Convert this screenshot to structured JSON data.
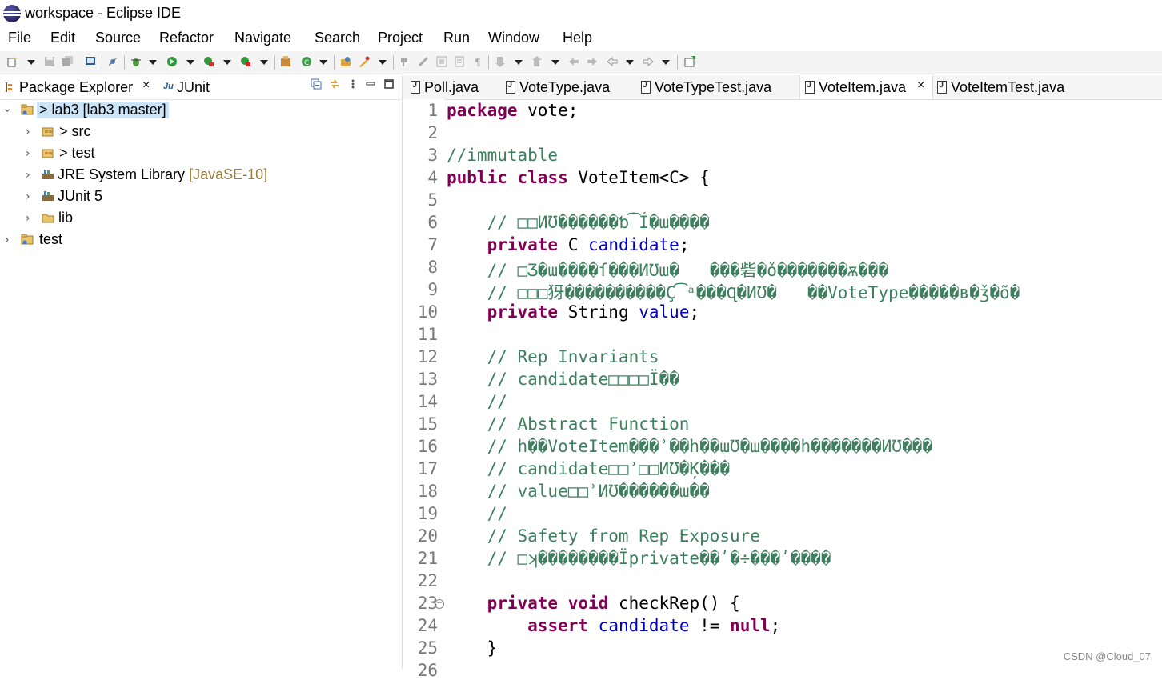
{
  "window": {
    "title": "workspace - Eclipse IDE"
  },
  "menu": [
    "File",
    "Edit",
    "Source",
    "Refactor",
    "Navigate",
    "Search",
    "Project",
    "Run",
    "Window",
    "Help"
  ],
  "left_view": {
    "tabs": [
      {
        "label": "Package Explorer",
        "icon": "package-icon"
      },
      {
        "label": "JUnit",
        "icon": "junit-icon"
      }
    ],
    "tree": [
      {
        "label": "> lab3 [lab3 master]",
        "icon": "project-icon",
        "level": 0,
        "expanded": true,
        "selected": true
      },
      {
        "label": "> src",
        "icon": "source-folder-icon",
        "level": 1,
        "expanded": false
      },
      {
        "label": "> test",
        "icon": "source-folder-icon",
        "level": 1,
        "expanded": false
      },
      {
        "label": "JRE System Library",
        "decoration": "[JavaSE-10]",
        "icon": "library-icon",
        "level": 1,
        "expanded": false
      },
      {
        "label": "JUnit 5",
        "icon": "library-icon",
        "level": 1,
        "expanded": false
      },
      {
        "label": "lib",
        "icon": "folder-icon",
        "level": 1,
        "expanded": false
      },
      {
        "label": "test",
        "icon": "project-icon",
        "level": 0,
        "expanded": false
      }
    ]
  },
  "editor": {
    "tabs": [
      {
        "label": "Poll.java",
        "active": false
      },
      {
        "label": "VoteType.java",
        "active": false
      },
      {
        "label": "VoteTypeTest.java",
        "active": false
      },
      {
        "label": "VoteItem.java",
        "active": true
      },
      {
        "label": "VoteItemTest.java",
        "active": false
      }
    ],
    "close_glyph": "×",
    "fold_glyph": "−",
    "line_numbers": [
      "1",
      "2",
      "3",
      "4",
      "5",
      "6",
      "7",
      "8",
      "9",
      "10",
      "11",
      "12",
      "13",
      "14",
      "15",
      "16",
      "17",
      "18",
      "19",
      "20",
      "21",
      "22",
      "23",
      "24",
      "25",
      "26"
    ],
    "lines": [
      [
        {
          "t": "package",
          "c": "kw"
        },
        {
          "t": " vote;",
          "c": ""
        }
      ],
      [],
      [
        {
          "t": "//immutable",
          "c": "cm"
        }
      ],
      [
        {
          "t": "public",
          "c": "kw"
        },
        {
          "t": " ",
          "c": ""
        },
        {
          "t": "class",
          "c": "kw"
        },
        {
          "t": " VoteItem<C> {",
          "c": ""
        }
      ],
      [],
      [
        {
          "t": "    // □□ИƱ������ƅ͡Í�ա����",
          "c": "cm"
        }
      ],
      [
        {
          "t": "    ",
          "c": ""
        },
        {
          "t": "private",
          "c": "kw"
        },
        {
          "t": " C ",
          "c": ""
        },
        {
          "t": "candidate",
          "c": "fld"
        },
        {
          "t": ";",
          "c": ""
        }
      ],
      [
        {
          "t": "    // □Ʒ�ա����ſ���ИƱա�   ���砦�ǒ�������ѫ���",
          "c": "cm"
        }
      ],
      [
        {
          "t": "    // □□□犽����������Ç͡ᵃ���Ɋ�ИƱ�   ��VoteType�����ʙ�ǯ�õ�",
          "c": "cm"
        }
      ],
      [
        {
          "t": "    ",
          "c": ""
        },
        {
          "t": "private",
          "c": "kw"
        },
        {
          "t": " String ",
          "c": ""
        },
        {
          "t": "value",
          "c": "fld"
        },
        {
          "t": ";",
          "c": ""
        }
      ],
      [],
      [
        {
          "t": "    // Rep Invariants",
          "c": "cm"
        }
      ],
      [
        {
          "t": "    // candidate□□□□Ï��",
          "c": "cm"
        }
      ],
      [
        {
          "t": "    //",
          "c": "cm"
        }
      ],
      [
        {
          "t": "    // Abstract Function",
          "c": "cm"
        }
      ],
      [
        {
          "t": "    // h��VoteItem���ʾ��h��աƱ�ա����h�������ИƱ���",
          "c": "cm"
        }
      ],
      [
        {
          "t": "    // candidate□□ʾ□□ИƱ�Ķ���",
          "c": "cm"
        }
      ],
      [
        {
          "t": "    // value□□ʾИƱ������ա��",
          "c": "cm"
        }
      ],
      [
        {
          "t": "    //",
          "c": "cm"
        }
      ],
      [
        {
          "t": "    // Safety from Rep Exposure",
          "c": "cm"
        }
      ],
      [
        {
          "t": "    // □ʞ��������Ïprivate��ʹ�÷���ʹ����",
          "c": "cm"
        }
      ],
      [],
      [
        {
          "t": "    ",
          "c": ""
        },
        {
          "t": "private",
          "c": "kw"
        },
        {
          "t": " ",
          "c": ""
        },
        {
          "t": "void",
          "c": "kw"
        },
        {
          "t": " checkRep() {",
          "c": ""
        }
      ],
      [
        {
          "t": "        ",
          "c": ""
        },
        {
          "t": "assert",
          "c": "kw"
        },
        {
          "t": " ",
          "c": ""
        },
        {
          "t": "candidate",
          "c": "fld"
        },
        {
          "t": " != ",
          "c": ""
        },
        {
          "t": "null",
          "c": "kw"
        },
        {
          "t": ";",
          "c": ""
        }
      ],
      [
        {
          "t": "    }",
          "c": ""
        }
      ],
      []
    ]
  },
  "watermark": "CSDN @Cloud_07",
  "colors": {
    "keyword": "#7f0055",
    "comment": "#3f7f5f",
    "field": "#0000c0",
    "line_number": "#787878",
    "selection": "#cce4f7"
  }
}
